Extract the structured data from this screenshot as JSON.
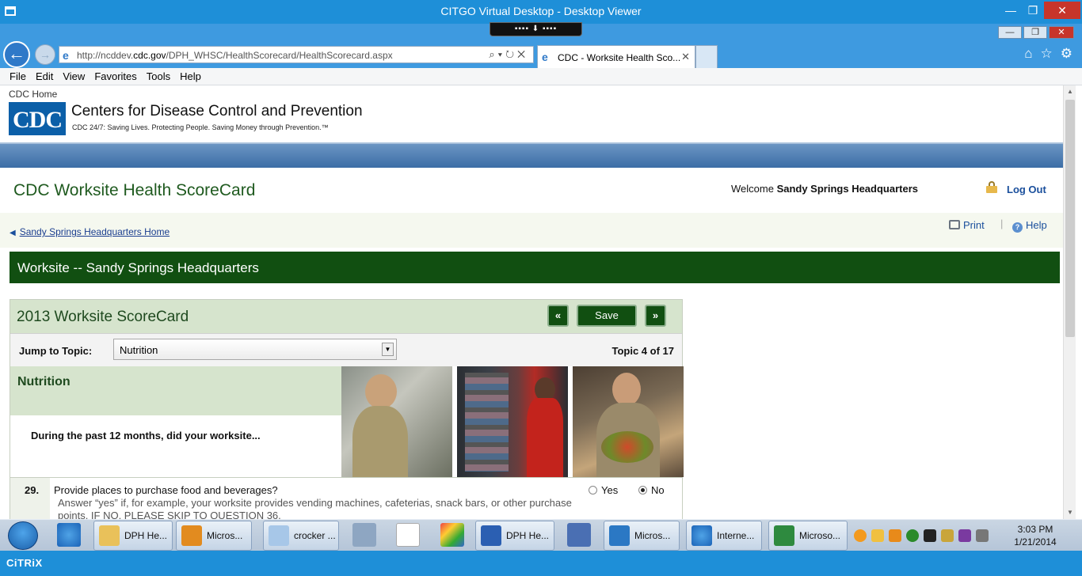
{
  "outer_window": {
    "title": "CITGO Virtual Desktop - Desktop Viewer"
  },
  "browser": {
    "url_prefix": "http://ncddev.",
    "url_domain": "cdc.gov",
    "url_path": "/DPH_WHSC/HealthScorecard/HealthScorecard.aspx",
    "tab_title": "CDC - Worksite Health Sco...",
    "menu": [
      "File",
      "Edit",
      "View",
      "Favorites",
      "Tools",
      "Help"
    ]
  },
  "cdc_header": {
    "home_link": "CDC Home",
    "logo_text": "CDC",
    "org_name": "Centers for Disease Control and Prevention",
    "tagline": "CDC 24/7: Saving Lives. Protecting People. Saving Money through Prevention.™"
  },
  "app": {
    "title": "CDC Worksite Health ScoreCard",
    "welcome_prefix": "Welcome ",
    "user": "Sandy Springs Headquarters",
    "logout": "Log Out",
    "breadcrumb": "Sandy Springs Headquarters Home",
    "print": "Print",
    "help": "Help",
    "worksite_bar": "Worksite -- Sandy Springs Headquarters"
  },
  "scorecard": {
    "title": "2013 Worksite ScoreCard",
    "prev": "«",
    "save": "Save",
    "next": "»",
    "jump_label": "Jump to Topic:",
    "jump_value": "Nutrition",
    "topic_counter": "Topic 4 of 17",
    "section": "Nutrition",
    "intro": "During the past 12 months, did your worksite...",
    "question": {
      "number": "29.",
      "text": "Provide places to purchase food and beverages?",
      "help": "Answer “yes” if, for example, your worksite provides vending machines, cafeterias, snack bars, or other purchase points. IF NO, PLEASE SKIP TO QUESTION 36.",
      "yes": "Yes",
      "no": "No",
      "selected": "No"
    }
  },
  "taskbar": {
    "items": [
      "DPH He...",
      "Micros...",
      "crocker ...",
      "DPH He...",
      "Micros...",
      "Interne...",
      "Microso..."
    ],
    "time": "3:03 PM",
    "date": "1/21/2014"
  },
  "citrix_footer": "CiTRiX",
  "colors": {
    "dark_green": "#114f11",
    "light_green": "#d6e4cd",
    "link_blue": "#1a4f9c",
    "window_blue": "#1e8fd8"
  }
}
